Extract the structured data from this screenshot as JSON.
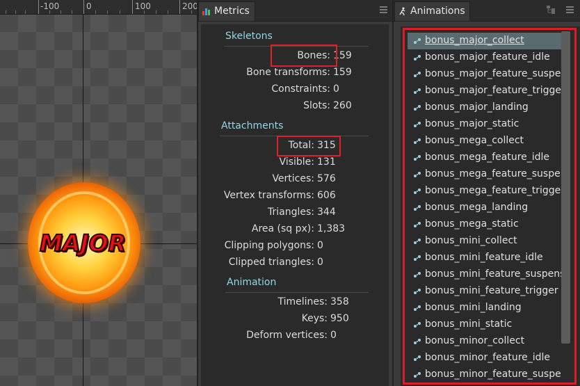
{
  "viewport": {
    "ruler_labels": [
      "-100",
      "0",
      "100",
      "200"
    ],
    "badge_text": "MAJOR"
  },
  "metrics": {
    "tab_label": "Metrics",
    "sections": [
      {
        "title": "Skeletons",
        "rows": [
          {
            "label": "Bones:",
            "value": "159"
          },
          {
            "label": "Bone transforms:",
            "value": "159"
          },
          {
            "label": "Constraints:",
            "value": "0"
          },
          {
            "label": "Slots:",
            "value": "260"
          }
        ]
      },
      {
        "title": "Attachments",
        "rows": [
          {
            "label": "Total:",
            "value": "315"
          },
          {
            "label": "Visible:",
            "value": "131"
          },
          {
            "label": "Vertices:",
            "value": "576"
          },
          {
            "label": "Vertex transforms:",
            "value": "606"
          },
          {
            "label": "Triangles:",
            "value": "344"
          },
          {
            "label": "Area (sq px):",
            "value": "1,383"
          },
          {
            "label": "Clipping polygons:",
            "value": "0"
          },
          {
            "label": "Clipped triangles:",
            "value": "0"
          }
        ]
      },
      {
        "title": "Animation",
        "rows": [
          {
            "label": "Timelines:",
            "value": "358"
          },
          {
            "label": "Keys:",
            "value": "950"
          },
          {
            "label": "Deform vertices:",
            "value": "0"
          }
        ]
      }
    ]
  },
  "animations": {
    "tab_label": "Animations",
    "selected": "bonus_major_collect",
    "items": [
      "bonus_major_collect",
      "bonus_major_feature_idle",
      "bonus_major_feature_suspense",
      "bonus_major_feature_trigger",
      "bonus_major_landing",
      "bonus_major_static",
      "bonus_mega_collect",
      "bonus_mega_feature_idle",
      "bonus_mega_feature_suspense",
      "bonus_mega_feature_trigger",
      "bonus_mega_landing",
      "bonus_mega_static",
      "bonus_mini_collect",
      "bonus_mini_feature_idle",
      "bonus_mini_feature_suspense",
      "bonus_mini_feature_trigger",
      "bonus_mini_landing",
      "bonus_mini_static",
      "bonus_minor_collect",
      "bonus_minor_feature_idle",
      "bonus_minor_feature_suspense"
    ]
  },
  "colors": {
    "section_heading": "#8fd8e8",
    "highlight_box": "#e0202a",
    "selected_row": "#5a6b6f"
  },
  "icons": {
    "metrics_tab": "bar-chart-icon",
    "animations_tab": "running-figure-icon",
    "animation_item": "animation-node-icon",
    "panel_menu": "hamburger-menu-icon",
    "tree_toggle": "tree-view-icon"
  }
}
